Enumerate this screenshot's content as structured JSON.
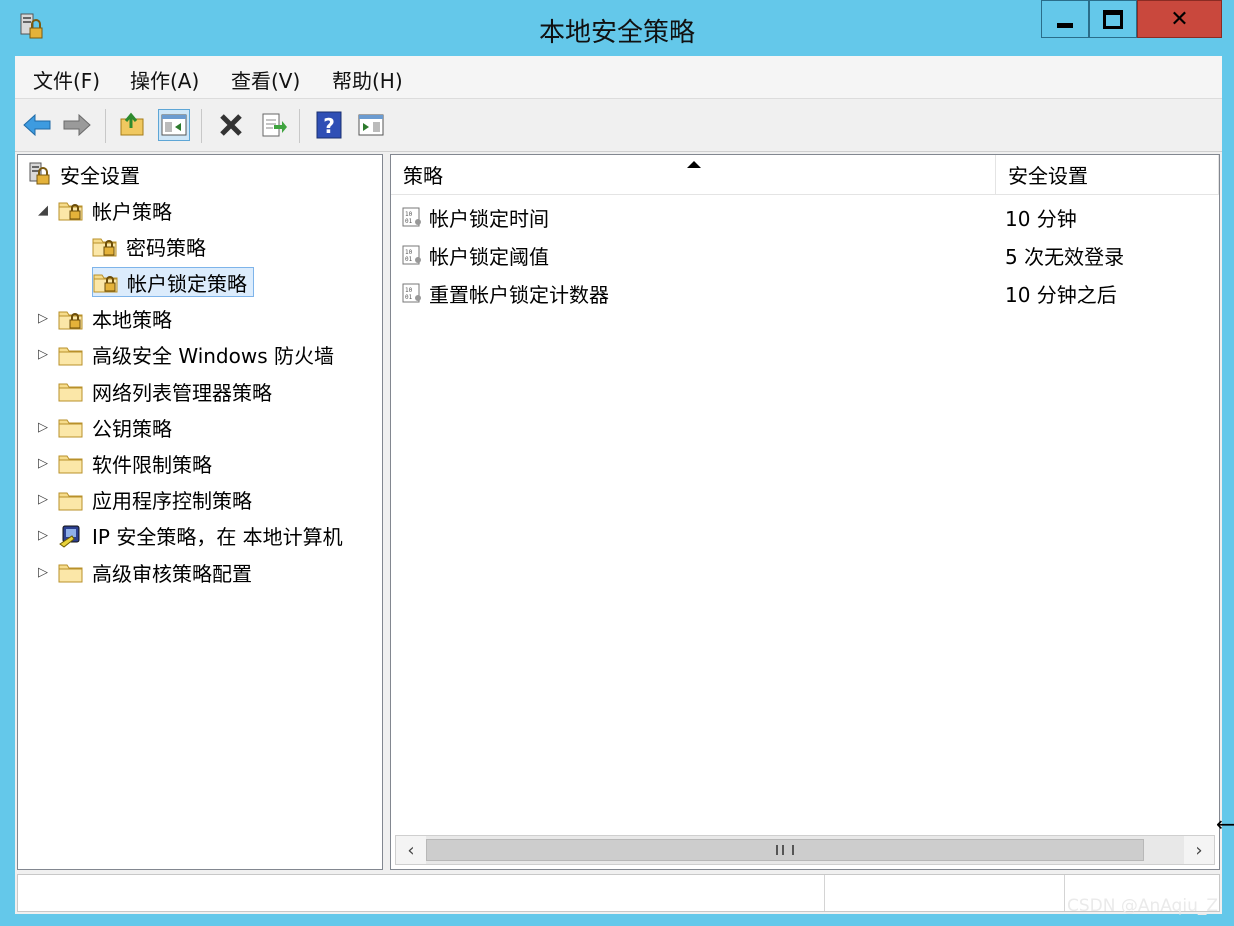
{
  "window": {
    "title": "本地安全策略"
  },
  "menu": {
    "file": "文件(F)",
    "action": "操作(A)",
    "view": "查看(V)",
    "help": "帮助(H)"
  },
  "toolbar": {
    "buttons": [
      {
        "icon": "back-arrow-icon"
      },
      {
        "icon": "forward-arrow-icon"
      },
      {
        "icon": "up-folder-icon"
      },
      {
        "icon": "show-hide-tree-icon"
      },
      {
        "icon": "delete-icon"
      },
      {
        "icon": "export-list-icon"
      },
      {
        "icon": "help-icon"
      },
      {
        "icon": "show-hide-action-pane-icon"
      }
    ]
  },
  "tree": {
    "root": "安全设置",
    "items": [
      {
        "label": "帐户策略",
        "expander": "open"
      },
      {
        "label": "密码策略",
        "expander": "none"
      },
      {
        "label": "帐户锁定策略",
        "expander": "none",
        "selected": true
      },
      {
        "label": "本地策略",
        "expander": "closed"
      },
      {
        "label": "高级安全 Windows 防火墙",
        "expander": "closed"
      },
      {
        "label": "网络列表管理器策略",
        "expander": "none"
      },
      {
        "label": "公钥策略",
        "expander": "closed"
      },
      {
        "label": "软件限制策略",
        "expander": "closed"
      },
      {
        "label": "应用程序控制策略",
        "expander": "closed"
      },
      {
        "label": "IP 安全策略，在 本地计算机",
        "expander": "closed"
      },
      {
        "label": "高级审核策略配置",
        "expander": "closed"
      }
    ]
  },
  "list": {
    "columns": [
      "策略",
      "安全设置"
    ],
    "rows": [
      {
        "policy": "帐户锁定时间",
        "setting": "10 分钟"
      },
      {
        "policy": "帐户锁定阈值",
        "setting": "5 次无效登录"
      },
      {
        "policy": "重置帐户锁定计数器",
        "setting": "10 分钟之后"
      }
    ]
  },
  "watermark": "CSDN @AnAqiu_Z",
  "colors": {
    "frame": "#64c8ea",
    "close_button": "#c9483d",
    "selection": "#dcecfc"
  }
}
